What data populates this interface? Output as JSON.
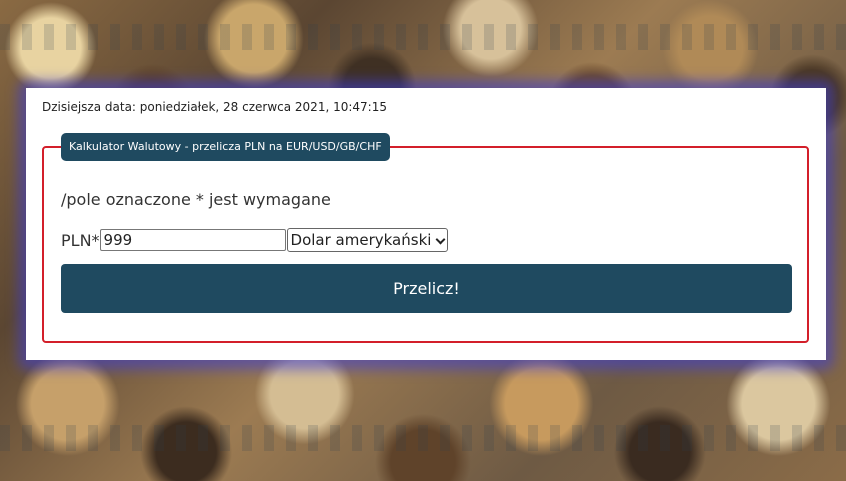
{
  "header": {
    "date_line": "Dzisiejsza data: poniedziałek, 28 czerwca 2021, 10:47:15"
  },
  "form": {
    "legend": "Kalkulator Walutowy - przelicza PLN na EUR/USD/GB/CHF",
    "required_note": "/pole oznaczone * jest wymagane",
    "amount_label": "PLN*",
    "amount_value": "999",
    "currency_selected": "Dolar amerykański",
    "submit_label": "Przelicz!"
  },
  "colors": {
    "panel_background": "#ffffff",
    "fieldset_border": "#d31f2a",
    "accent": "#1f4a60",
    "panel_glow": "#3c3cd2"
  },
  "icons": {
    "select_arrow": "chevron-down-icon"
  }
}
